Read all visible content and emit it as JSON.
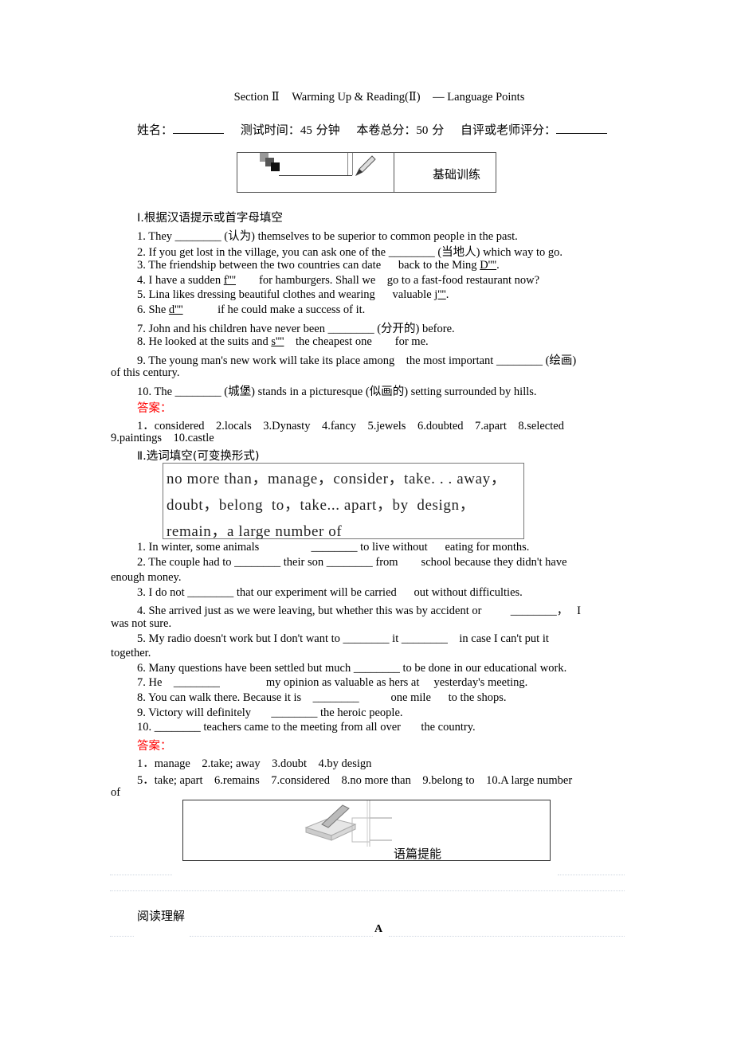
{
  "header": {
    "section": "Section Ⅱ",
    "unit": "Warming Up & Reading(Ⅱ)",
    "topic": "— Language Points"
  },
  "meta": {
    "name_label": "姓名：",
    "time_label": "测试时间：",
    "time_value": "45",
    "time_unit": "分钟",
    "score_label": "本卷总分：",
    "score_value": "50",
    "score_unit": "分",
    "grade_label": "自评或老师评分："
  },
  "banner1": {
    "icon": "pencil-icon",
    "label": "基础训练"
  },
  "part1": {
    "heading": "Ⅰ.根据汉语提示或首字母填空",
    "items": [
      {
        "pre": "1. They ",
        "blank": "________",
        "post": " (认为) themselves to be superior to       common people in the past."
      },
      {
        "pre": "2. If you get lost in the village, you can ask one of the ",
        "blank": "________",
        "post": " (当地人) which way to go."
      },
      {
        "pre": "3. The friendship between the two countries can date      back to the Ming ",
        "hint": "D''''",
        "post": "."
      },
      {
        "pre": "4. I have a sudden ",
        "hint": "f''''",
        "post": "        for hamburgers. Shall we    go to a fast-food restaurant now?"
      },
      {
        "pre": "5. Lina likes dressing beautiful clothes and wearing      valuable ",
        "hint": "j''''",
        "post": "."
      },
      {
        "pre": "6. She ",
        "hint": "d''''",
        "post": "            if he could make a success of it."
      },
      {
        "pre": "7. John and his children have never been ",
        "blank": "________",
        "post": " (分开的) before."
      },
      {
        "pre": "8. He looked at the suits and ",
        "hint": "s''''",
        "post": "    the cheapest one        for me."
      },
      {
        "pre": "9. The young man's new work will take its place among    the most important ",
        "blank": "________",
        "post": " (绘画)",
        "cont": "of this century."
      },
      {
        "pre": "10. The ",
        "blank": "________",
        "post": " (城堡) stands in a picturesque (似画的) setting surrounded by hills."
      }
    ],
    "answer_label": "答案：",
    "answers_line1": "1．considered    2.locals    3.Dynasty    4.fancy    5.jewels    6.doubted    7.apart    8.selected",
    "answers_line2": "9.paintings    10.castle"
  },
  "part2": {
    "heading": "Ⅱ.选词填空(可变换形式)",
    "word_box": [
      "no more than，manage，consider，take. . . away，",
      "doubt，belong  to，take... apart，by  design，",
      "remain，a large number of"
    ],
    "items": [
      {
        "text": "1. In winter, some animals                  ________ to live without      eating for months."
      },
      {
        "text": "2. The couple had to ________ their son ________ from        school because they didn't have",
        "cont": "enough money."
      },
      {
        "text": "3. I do not ________ that our experiment will be carried      out without difficulties."
      },
      {
        "text": "4. She arrived just as we were leaving, but whether this was by accident or          ________，   I",
        "cont": "was not sure."
      },
      {
        "text": "5. My radio doesn't work but I don't want to ________ it ________    in case I can't put it",
        "cont": "together."
      },
      {
        "text": "6. Many questions have been settled but much ________ to be done in our educational work."
      },
      {
        "text": "7. He    ________                my opinion as valuable as hers at     yesterday's meeting."
      },
      {
        "text": "8. You can walk there. Because it is    ________           one mile      to the shops."
      },
      {
        "text": "9. Victory will definitely       ________ the heroic people."
      },
      {
        "text": "10. ________ teachers came to the meeting from all over       the country."
      }
    ],
    "answer_label": "答案：",
    "answers_line1": "1．manage    2.take; away    3.doubt    4.by design",
    "answers_line2": "5．take; apart    6.remains    7.considered    8.no more than    9.belong to    10.A large number",
    "answers_line3": "of"
  },
  "banner2": {
    "icon": "book-pen-icon",
    "label": "语篇提能"
  },
  "part3": {
    "heading": "阅读理解",
    "passage_label": "A"
  },
  "colors": {
    "answer": "#ff0000",
    "text": "#000000"
  }
}
